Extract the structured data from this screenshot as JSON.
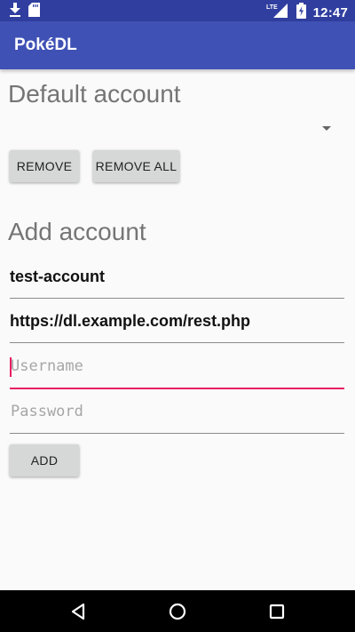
{
  "status_bar": {
    "time": "12:47",
    "network": "LTE",
    "left_icons": [
      "download-icon",
      "sd-card-icon"
    ],
    "right_icons": [
      "signal-icon",
      "battery-icon"
    ]
  },
  "toolbar": {
    "title": "PokéDL"
  },
  "default_account": {
    "heading": "Default account",
    "selected_value": "",
    "remove_label": "REMOVE",
    "remove_all_label": "REMOVE ALL"
  },
  "add_account": {
    "heading": "Add account",
    "name_value": "test-account",
    "url_value": "https://dl.example.com/rest.php",
    "username_placeholder": "Username",
    "password_placeholder": "Password",
    "add_label": "ADD"
  },
  "colors": {
    "status_bar": "#303f9f",
    "toolbar": "#3f51b5",
    "accent": "#e91e63",
    "background": "#fafafa"
  },
  "nav_icons": [
    "back-icon",
    "home-icon",
    "recents-icon"
  ]
}
